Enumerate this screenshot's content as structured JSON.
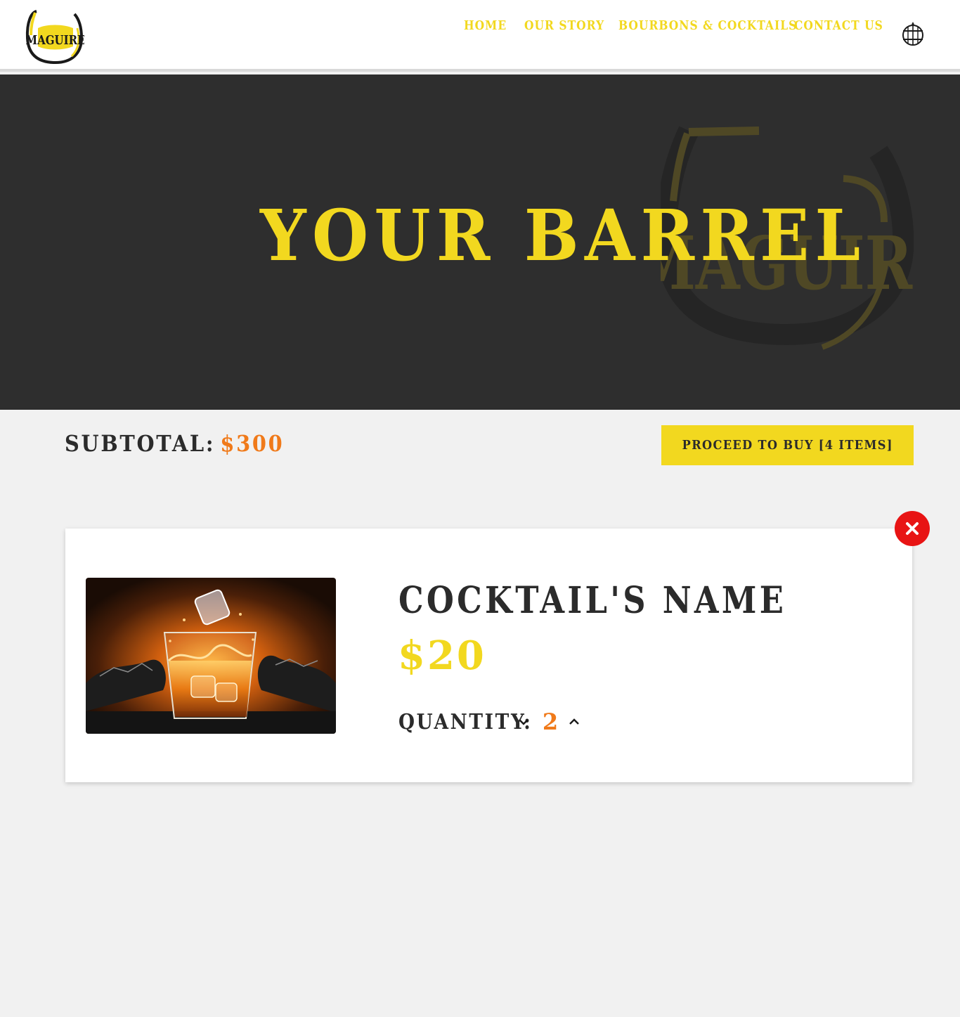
{
  "header": {
    "logo_text": "MAGUIRE",
    "nav": [
      {
        "label": "HOME"
      },
      {
        "label": "OUR STORY"
      },
      {
        "label": "BOURBONS & COCKTAILS"
      },
      {
        "label": "CONTACT US"
      }
    ],
    "cart_icon": "barrel-icon"
  },
  "hero": {
    "title": "YOUR BARREL",
    "watermark_text": "MAGUIRE"
  },
  "summary": {
    "subtotal_label": "SUBTOTAL:",
    "subtotal_value": "$300",
    "proceed_label": "PROCEED TO BUY [4 ITEMS]"
  },
  "cart": {
    "items": [
      {
        "name": "COCKTAIL'S NAME",
        "price": "$20",
        "quantity_label": "QUANTITY:",
        "quantity": "2",
        "image": "whiskey-glass-photo"
      }
    ],
    "remove_icon": "close-icon"
  },
  "colors": {
    "accent_yellow": "#f2d81f",
    "accent_orange": "#f07a1a",
    "dark": "#2e2e2e",
    "remove_red": "#e81414"
  }
}
